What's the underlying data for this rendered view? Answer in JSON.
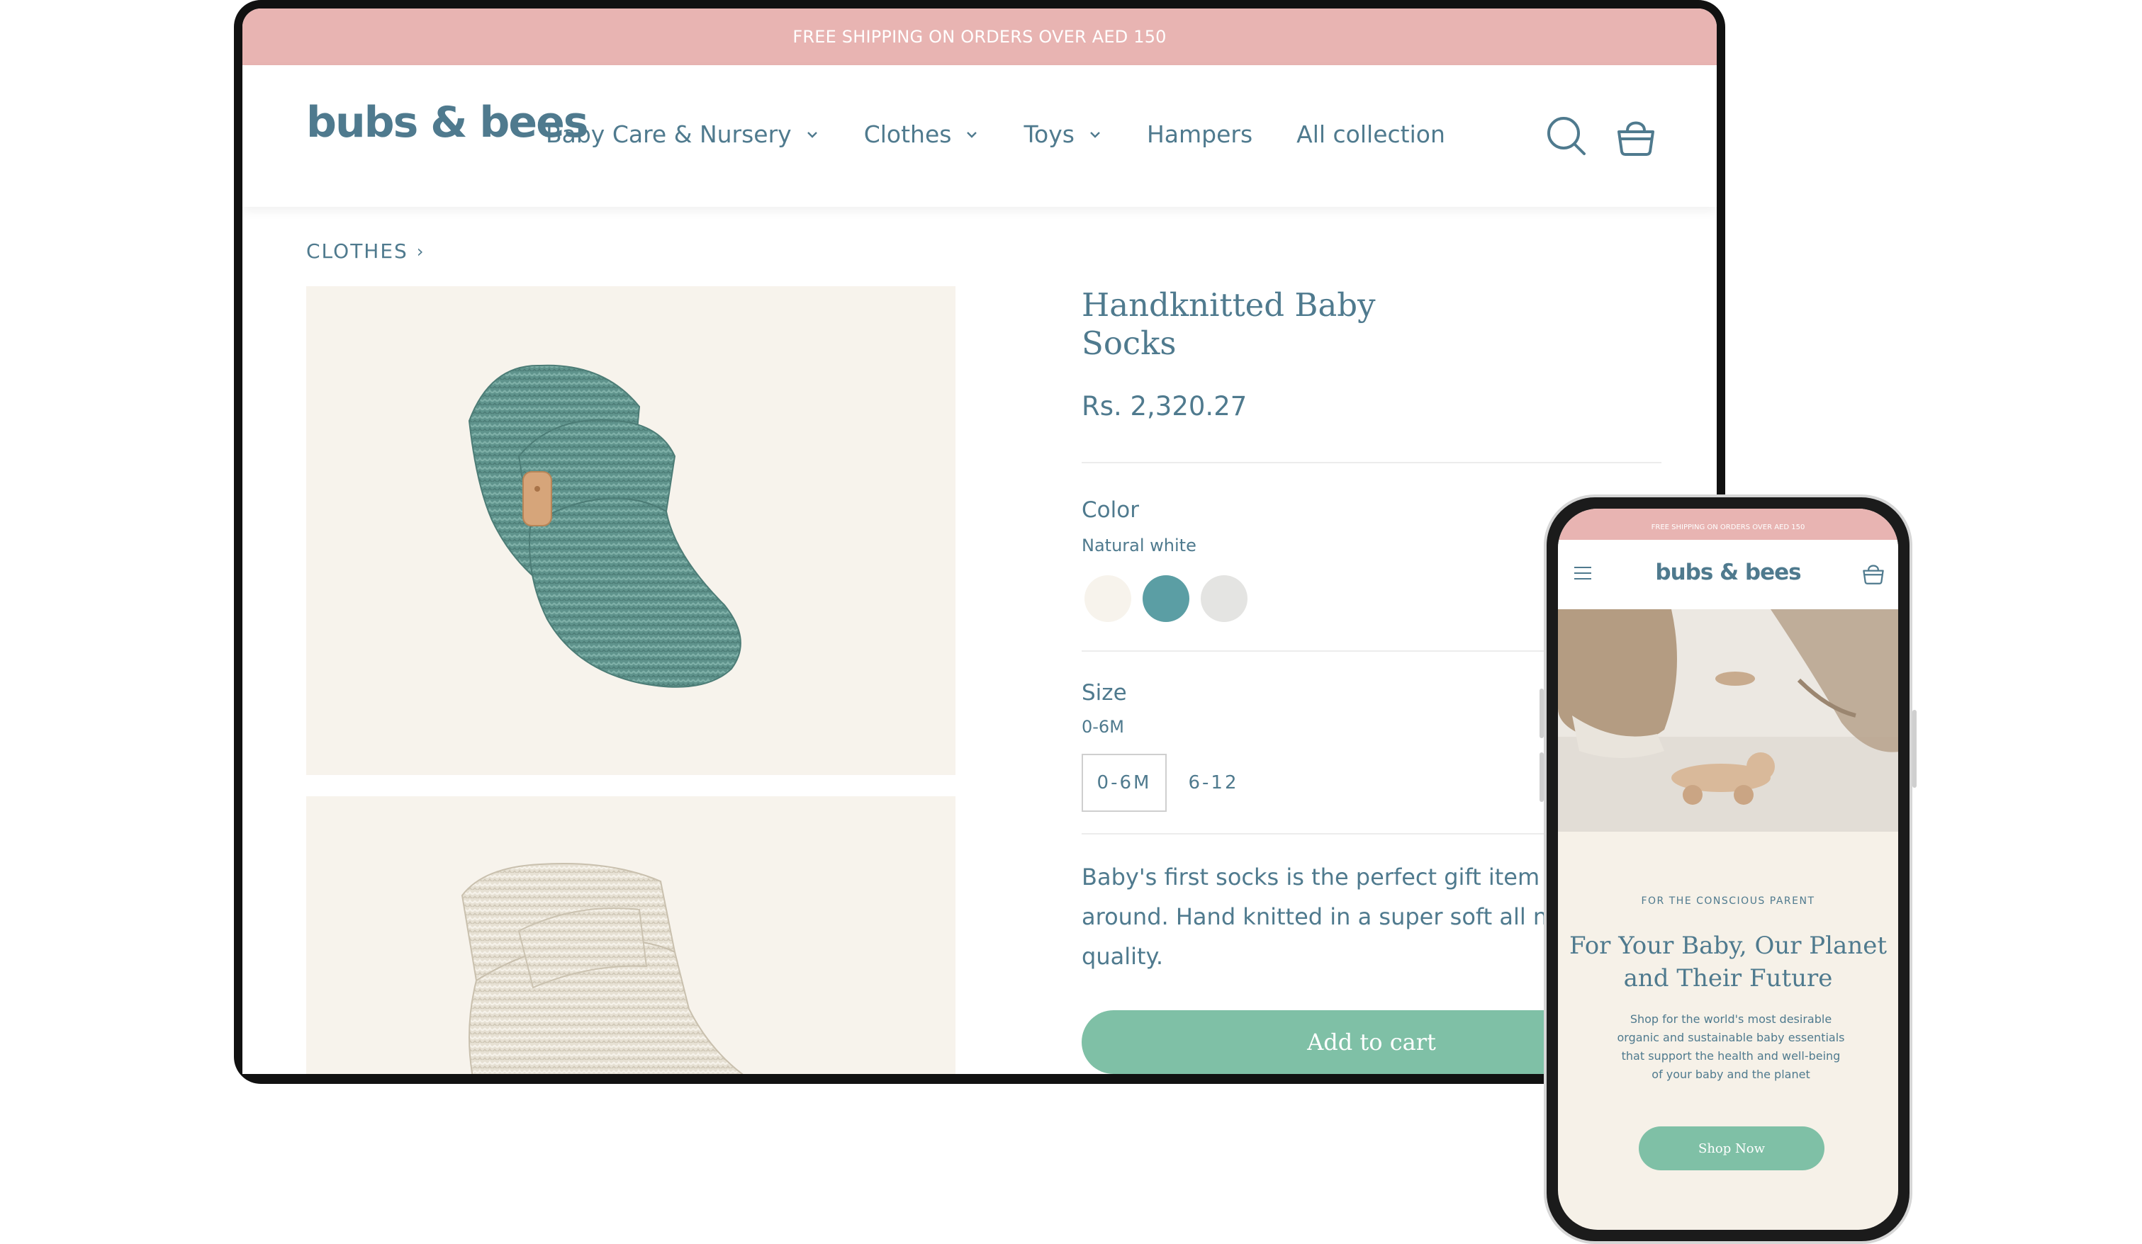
{
  "desktop": {
    "announcement": "FREE SHIPPING ON ORDERS OVER AED 150",
    "logo": "bubs & bees",
    "nav": [
      {
        "label": "Baby Care & Nursery",
        "dropdown": true
      },
      {
        "label": "Clothes",
        "dropdown": true
      },
      {
        "label": "Toys",
        "dropdown": true
      },
      {
        "label": "Hampers",
        "dropdown": false
      },
      {
        "label": "All collection",
        "dropdown": false
      }
    ],
    "icons": {
      "search": "search-icon",
      "cart": "shopping-bag-icon"
    },
    "breadcrumb": {
      "label": "CLOTHES",
      "separator": "›"
    },
    "product": {
      "title_line1": "Handknitted Baby",
      "title_line2": "Socks",
      "price": "Rs. 2,320.27",
      "color_label": "Color",
      "color_value": "Natural white",
      "colors": [
        "#f7f3ec",
        "#5b9ea4",
        "#e4e4e2"
      ],
      "size_label": "Size",
      "size_value": "0-6M",
      "sizes": [
        "0-6M",
        "6-12"
      ],
      "description_line1": "Baby's first socks is the perfect gift item all",
      "description_line2": "around. Hand knitted in a super soft all natu",
      "description_line3": "quality.",
      "add_to_cart": "Add to cart"
    }
  },
  "mobile": {
    "announcement": "FREE SHIPPING ON ORDERS OVER AED 150",
    "logo": "bubs & bees",
    "kicker": "FOR THE CONSCIOUS PARENT",
    "headline_line1": "For Your Baby, Our Planet",
    "headline_line2": "and Their Future",
    "subtext": "Shop for the world's most desirable organic and sustainable baby essentials that support the health and well-being of your baby and the planet",
    "cta": "Shop Now"
  },
  "colors": {
    "brand_text": "#4f7a8e",
    "announcement_bg": "#e8b4b2",
    "button_green": "#7fc0a6",
    "image_bg": "#f7f3ec"
  }
}
